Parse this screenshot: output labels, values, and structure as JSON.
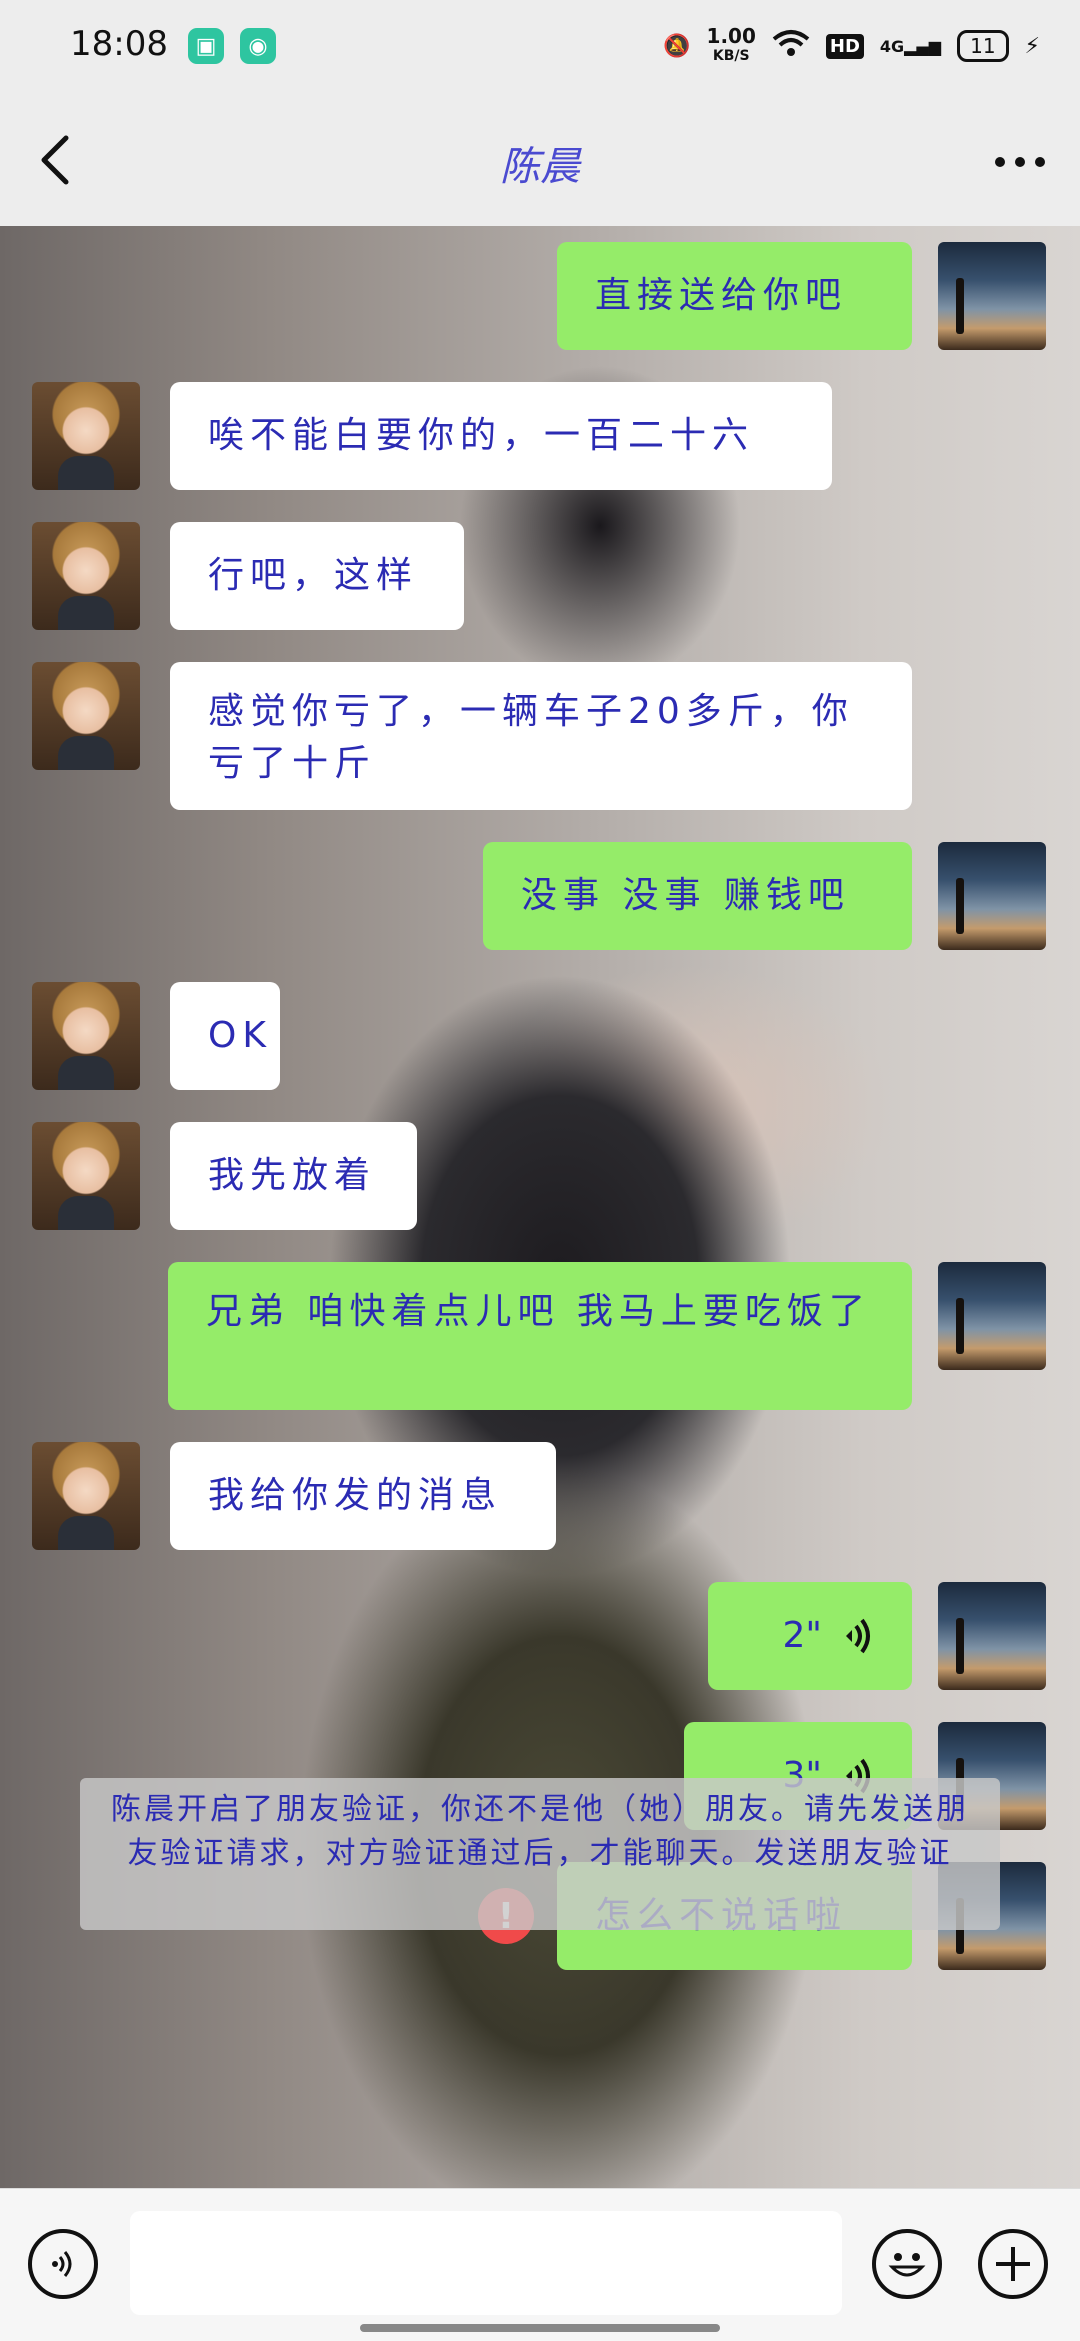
{
  "status_bar": {
    "time": "18:08",
    "net_speed": "1.00",
    "net_unit": "KB/S",
    "hd": "HD",
    "network": "4G",
    "battery": "11"
  },
  "header": {
    "title": "陈晨"
  },
  "messages": [
    {
      "side": "me",
      "type": "text",
      "text": "直接送给你吧"
    },
    {
      "side": "friend",
      "type": "text",
      "text": "唉不能白要你的，一百二十六"
    },
    {
      "side": "friend",
      "type": "text",
      "text": "行吧，这样"
    },
    {
      "side": "friend",
      "type": "text",
      "text": "感觉你亏了，一辆车子20多斤，你亏了十斤"
    },
    {
      "side": "me",
      "type": "text",
      "text": "没事 没事 赚钱吧"
    },
    {
      "side": "friend",
      "type": "text",
      "text": "OK"
    },
    {
      "side": "friend",
      "type": "text",
      "text": "我先放着"
    },
    {
      "side": "me",
      "type": "text",
      "text": "兄弟 咱快着点儿吧 我马上要吃饭了"
    },
    {
      "side": "friend",
      "type": "text",
      "text": "我给你发的消息"
    },
    {
      "side": "me",
      "type": "voice",
      "text": "2\""
    },
    {
      "side": "me",
      "type": "voice",
      "text": "3\""
    },
    {
      "side": "me",
      "type": "text",
      "text": "怎么不说话啦",
      "failed": true
    }
  ],
  "system_notice": {
    "text": "陈晨开启了朋友验证，你还不是他（她）朋友。请先发送朋友验证请求，对方验证通过后，才能聊天。",
    "link": "发送朋友验证"
  },
  "input_bar": {
    "placeholder": ""
  },
  "colors": {
    "me_bubble": "#95ec69",
    "friend_bubble": "#ffffff",
    "text": "#2b2bb3",
    "error": "#f04a4a"
  },
  "icons": [
    "back-icon",
    "more-icon",
    "voice-wave-icon",
    "error-icon",
    "voice-toggle-icon",
    "emoji-icon",
    "plus-icon"
  ]
}
